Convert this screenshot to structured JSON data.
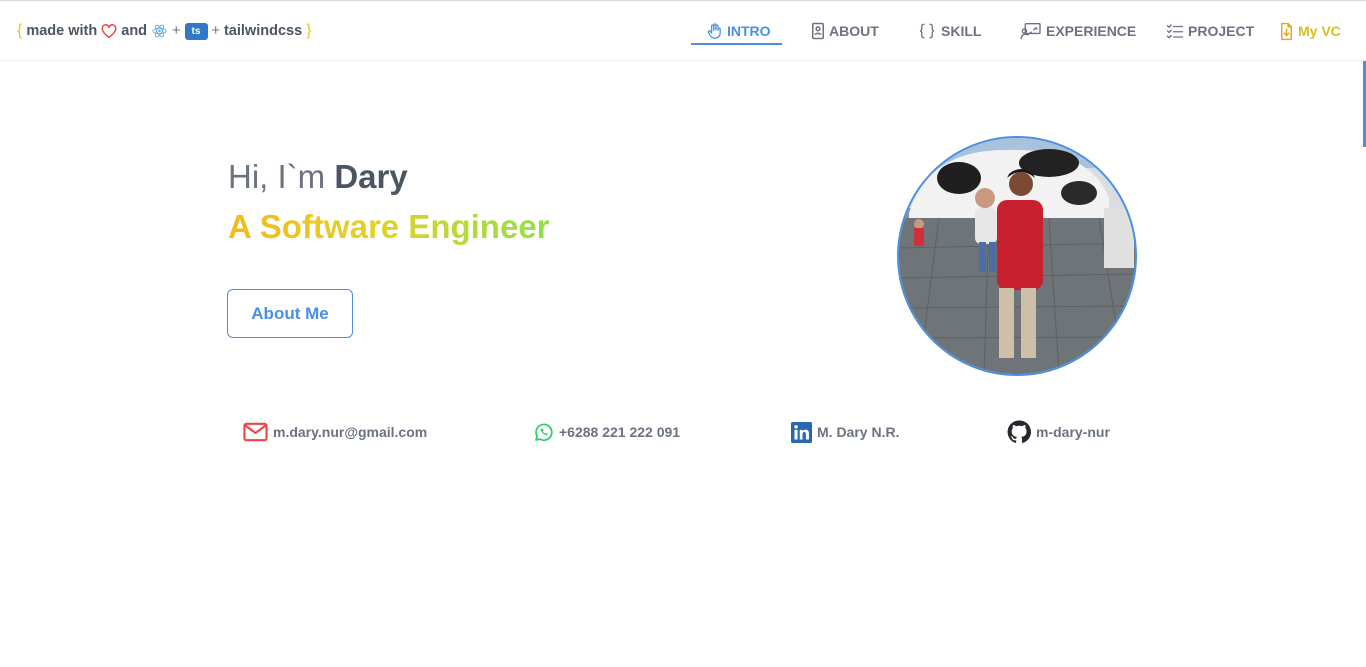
{
  "brand": {
    "open_brace": "{",
    "made_with": "made with",
    "and": "and",
    "plus1": "+",
    "ts_badge": "ts",
    "plus2": "+",
    "tailwind": "tailwindcss",
    "close_brace": "}",
    "icons": [
      "heart-icon",
      "react-icon",
      "typescript-badge"
    ]
  },
  "nav": {
    "items": [
      {
        "label": "INTRO",
        "icon": "hand-icon",
        "active": true
      },
      {
        "label": "ABOUT",
        "icon": "id-card-icon",
        "active": false
      },
      {
        "label": "SKILL",
        "icon": "braces-icon",
        "active": false
      },
      {
        "label": "EXPERIENCE",
        "icon": "presentation-icon",
        "active": false
      },
      {
        "label": "PROJECT",
        "icon": "checklist-icon",
        "active": false
      },
      {
        "label": "My VC",
        "icon": "download-file-icon",
        "active": false
      }
    ]
  },
  "hero": {
    "greeting": "Hi, I`m ",
    "name": "Dary",
    "role": "A Software Engineer",
    "cta_label": "About Me"
  },
  "contacts": [
    {
      "label": "m.dary.nur@gmail.com",
      "icon": "mail-icon"
    },
    {
      "label": "+6288 221 222 091",
      "icon": "whatsapp-icon"
    },
    {
      "label": "M. Dary N.R.",
      "icon": "linkedin-icon"
    },
    {
      "label": "m-dary-nur",
      "icon": "github-icon"
    }
  ],
  "colors": {
    "accent": "#4a90e2",
    "text": "#4b5563",
    "muted": "#6b7280",
    "gradient_start": "#f5b91a",
    "gradient_end": "#8ee04a",
    "mail": "#ef4444",
    "whatsapp": "#25d366",
    "linkedin": "#2867b2",
    "vc": "#d6c11a"
  }
}
